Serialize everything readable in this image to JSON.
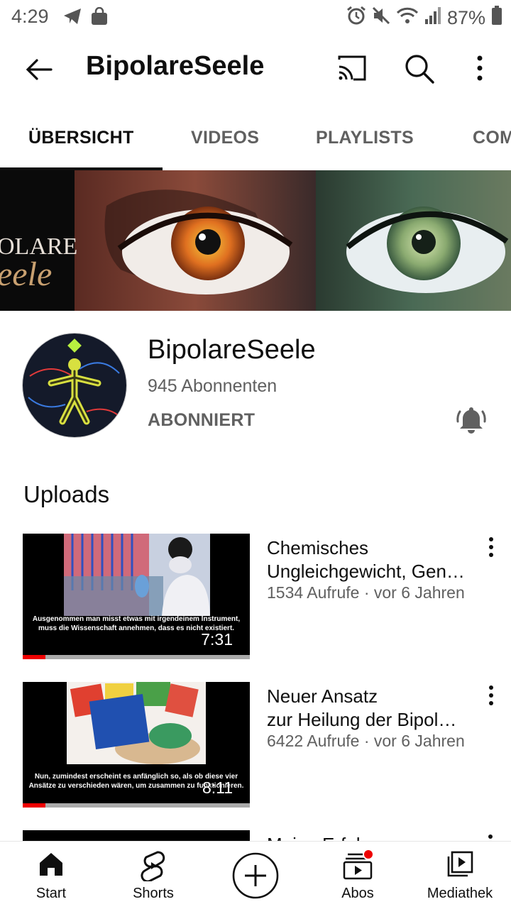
{
  "status_bar": {
    "time": "4:29",
    "battery": "87%",
    "icons": [
      "telegram-icon",
      "shopping-bag-icon",
      "alarm-icon",
      "mute-icon",
      "wifi-icon",
      "signal-icon",
      "battery-icon"
    ]
  },
  "app_bar": {
    "title": "BipolareSeele",
    "icons": [
      "back-arrow-icon",
      "cast-icon",
      "search-icon",
      "more-vert-icon"
    ]
  },
  "tabs": [
    {
      "label": "ÜBERSICHT",
      "active": true
    },
    {
      "label": "VIDEOS"
    },
    {
      "label": "PLAYLISTS"
    },
    {
      "label": "COMMUNITY"
    }
  ],
  "banner": {
    "logo_line1": "OLARE",
    "logo_line2": "eele"
  },
  "channel": {
    "name": "BipolareSeele",
    "subscribers": "945 Abonnenten",
    "subscribe_state": "ABONNIERT"
  },
  "uploads": {
    "section_title": "Uploads",
    "videos": [
      {
        "title_line1": "Chemisches",
        "title_line2": "Ungleichgewicht, Gen…",
        "meta": "1534 Aufrufe · vor 6 Jahren",
        "duration": "7:31",
        "subtitle": "Ausgenommen man misst etwas mit irgendeinem Instrument, muss die Wissenschaft annehmen, dass es nicht existiert.",
        "watched_fraction": 0.1
      },
      {
        "title_line1": "Neuer Ansatz",
        "title_line2": "zur Heilung der Bipol…",
        "meta": "6422 Aufrufe · vor 6 Jahren",
        "duration": "8:11",
        "subtitle": "Nun, zumindest erscheint es anfänglich so, als ob diese vier Ansätze zu verschieden wären, um zusammen zu funktionieren.",
        "watched_fraction": 0.1
      },
      {
        "title_line1": "Meine Erfahrungen"
      }
    ]
  },
  "bottom_nav": [
    {
      "label": "Start",
      "icon": "home-icon",
      "active": true
    },
    {
      "label": "Shorts",
      "icon": "shorts-icon"
    },
    {
      "label": "",
      "icon": "create-plus-icon"
    },
    {
      "label": "Abos",
      "icon": "subscriptions-icon",
      "badge": true
    },
    {
      "label": "Mediathek",
      "icon": "library-icon"
    }
  ],
  "colors": {
    "accent_red": "#ee0000",
    "text_primary": "#0f0f0f",
    "text_secondary": "#606060"
  }
}
